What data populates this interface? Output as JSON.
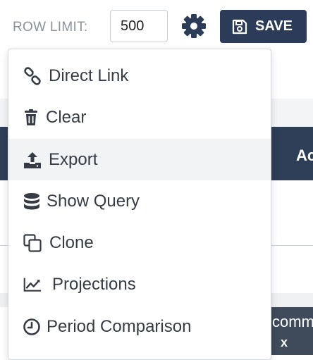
{
  "toolbar": {
    "row_limit_label": "ROW LIMIT:",
    "row_limit_value": "500",
    "save_label": "SAVE"
  },
  "menu": {
    "items": [
      {
        "label": "Direct Link",
        "icon": "link-icon"
      },
      {
        "label": "Clear",
        "icon": "trash-icon"
      },
      {
        "label": "Export",
        "icon": "upload-icon",
        "active": true
      },
      {
        "label": "Show Query",
        "icon": "database-icon"
      },
      {
        "label": "Clone",
        "icon": "clone-icon"
      },
      {
        "label": "Projections",
        "icon": "line-chart-icon"
      },
      {
        "label": "Period Comparison",
        "icon": "clock-icon"
      }
    ]
  },
  "background": {
    "header_text": "Ac",
    "chip_label": "comm",
    "chip_close": "x"
  },
  "colors": {
    "primary": "#2c3b57",
    "menu_text": "#353c45",
    "label_gray": "#8a939e",
    "active_row": "#f2f3f4"
  }
}
